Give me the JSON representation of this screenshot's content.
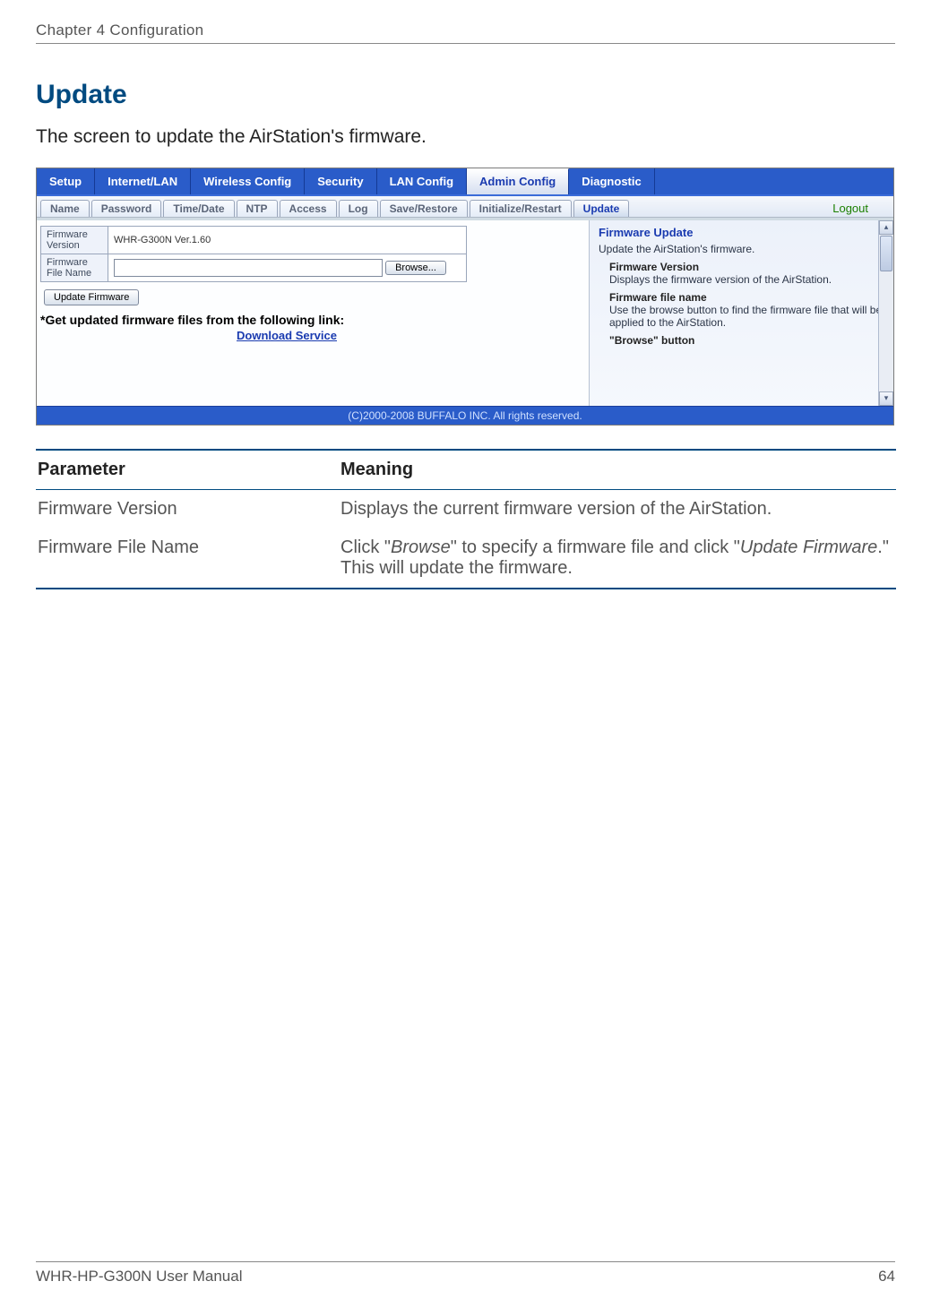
{
  "doc": {
    "chapter_header": "Chapter 4  Configuration",
    "section_title": "Update",
    "section_intro": "The screen to update the AirStation's firmware.",
    "footer_left": "WHR-HP-G300N User Manual",
    "footer_right": "64"
  },
  "shot": {
    "main_tabs": [
      "Setup",
      "Internet/LAN",
      "Wireless Config",
      "Security",
      "LAN Config",
      "Admin Config",
      "Diagnostic"
    ],
    "main_tab_active_index": 5,
    "sub_tabs": [
      "Name",
      "Password",
      "Time/Date",
      "NTP",
      "Access",
      "Log",
      "Save/Restore",
      "Initialize/Restart",
      "Update"
    ],
    "sub_tab_active_index": 8,
    "logout_label": "Logout",
    "fv_label": "Firmware Version",
    "fv_value": "WHR-G300N Ver.1.60",
    "fname_label": "Firmware File Name",
    "file_value": "",
    "browse_label": "Browse...",
    "update_btn_label": "Update Firmware",
    "link_note": "*Get updated firmware files from the following link:",
    "download_link_label": "Download Service",
    "help": {
      "title": "Firmware Update",
      "intro": "Update the AirStation's firmware.",
      "s1_title": "Firmware Version",
      "s1_text": "Displays the firmware version of the AirStation.",
      "s2_title": "Firmware file name",
      "s2_text": "Use the browse button to find the firmware file that will be applied to the AirStation.",
      "s3_title": "\"Browse\" button"
    },
    "footer_text": "(C)2000-2008 BUFFALO INC. All rights reserved."
  },
  "table": {
    "hdr_param": "Parameter",
    "hdr_mean": "Meaning",
    "rows": [
      {
        "param": "Firmware Version",
        "mean": "Displays the current firmware version of the AirStation."
      },
      {
        "param": "Firmware File Name",
        "mean_pre": "Click \"",
        "mean_em1": "Browse",
        "mean_mid": "\" to specify a  firmware file and click \"",
        "mean_em2": "Update Firmware",
        "mean_post": ".\" This will update the firmware."
      }
    ]
  }
}
